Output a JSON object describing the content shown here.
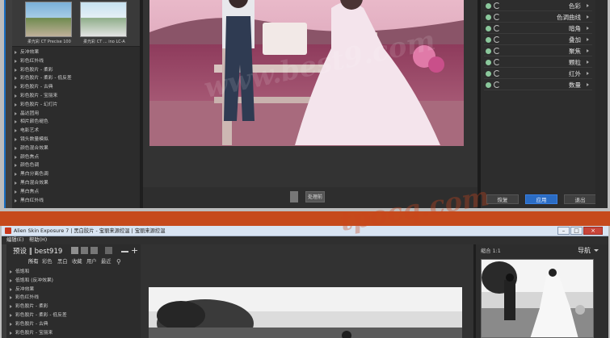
{
  "top_window": {
    "thumbnails": [
      {
        "caption": "柔光彩 CT Precise 100"
      },
      {
        "caption": "柔光彩 CT ... ino LC-A"
      }
    ],
    "preset_items": [
      "反冲效果",
      "彩色红外线",
      "彩色胶片 - 柔彩",
      "彩色胶片 - 柔彩 - 低反差",
      "彩色胶片 - 古典",
      "彩色胶片 - 宝丽来",
      "彩色胶片 - 幻灯片",
      "晶达团用",
      "相片颜色褪色",
      "电影艺术",
      "镜头数量模拟",
      "颜色混合效果",
      "颜色焦点",
      "颜色色调",
      "黑白分离色调",
      "黑白混合效果",
      "黑白焦点",
      "黑白红外线"
    ],
    "bottom_bar": {
      "apply_label": "处理前"
    },
    "adjustments": [
      "色彩",
      "色调曲线",
      "暗角",
      "叠加",
      "聚焦",
      "颗粒",
      "红外",
      "数量"
    ],
    "buttons": {
      "reset": "恢复",
      "apply": "应用",
      "exit": "退出"
    }
  },
  "bottom_window": {
    "title": "Alien Skin Exposure 7 | 黑白胶片 - 宝丽来源控温 | 宝丽来源控温",
    "menu": [
      "编辑(E)",
      "帮助(H)"
    ],
    "window_controls": {
      "minimize": "–",
      "maximize": "□",
      "close": "×"
    },
    "preset_header": "预设 ‖ best919",
    "tabs": [
      "所有",
      "彩色",
      "黑白",
      "收藏",
      "用户",
      "最近"
    ],
    "preset_items": [
      "低饱和",
      "低饱和 (反冲效果)",
      "反冲效果",
      "彩色红外线",
      "彩色胶片 - 柔彩",
      "彩色胶片 - 柔彩 - 低反差",
      "彩色胶片 - 古典",
      "彩色胶片 - 宝丽来"
    ],
    "zoom": "缩合 1:1",
    "navigator": "导航"
  },
  "watermarks": [
    "www.best9.com",
    "tpocq.com"
  ],
  "colors": {
    "accent": "#2a6cc4",
    "band": "#c64a1c",
    "panel": "#2c2c2c"
  }
}
